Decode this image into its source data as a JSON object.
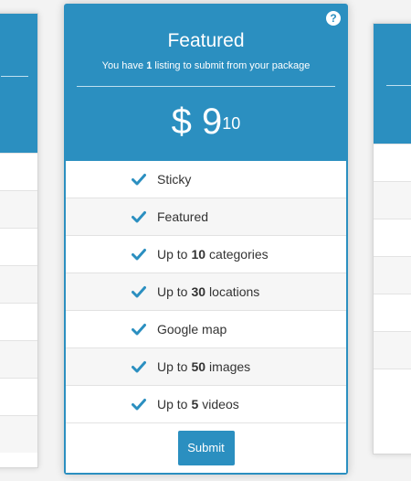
{
  "plan": {
    "title": "Featured",
    "subtitle_prefix": "You have",
    "subtitle_count": "1",
    "subtitle_suffix": "listing to submit from your package",
    "price_currency": "$",
    "price_main": "9",
    "price_cents": "10",
    "help_symbol": "?"
  },
  "features": [
    {
      "pre": "Sticky",
      "bold": "",
      "post": ""
    },
    {
      "pre": "Featured",
      "bold": "",
      "post": ""
    },
    {
      "pre": "Up to",
      "bold": "10",
      "post": "categories"
    },
    {
      "pre": "Up to",
      "bold": "30",
      "post": "locations"
    },
    {
      "pre": "Google map",
      "bold": "",
      "post": ""
    },
    {
      "pre": "Up to",
      "bold": "50",
      "post": "images"
    },
    {
      "pre": "Up to",
      "bold": "5",
      "post": "videos"
    }
  ],
  "actions": {
    "submit_label": "Submit"
  },
  "icons": {
    "feature": "check-icon",
    "help": "help-icon"
  },
  "colors": {
    "accent": "#2b8fc0",
    "text": "#333333"
  }
}
